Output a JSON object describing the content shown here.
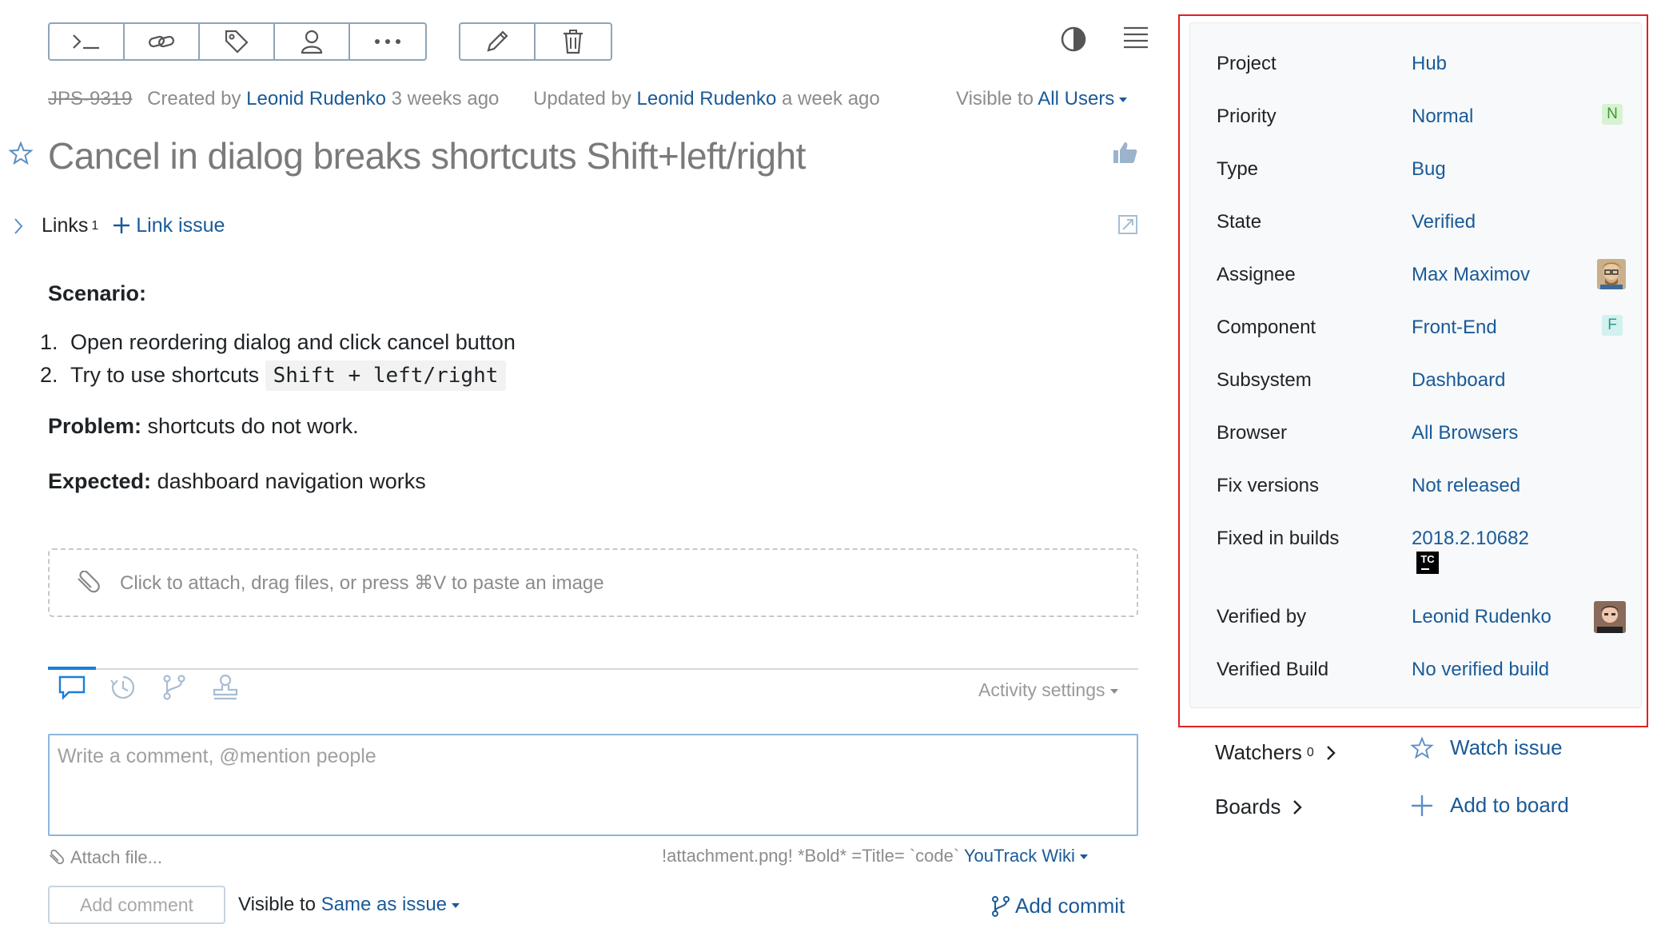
{
  "toolbar": {
    "group1": [
      "terminal-icon",
      "link-icon",
      "tag-icon",
      "user-icon",
      "more-icon"
    ],
    "group2": [
      "pencil-icon",
      "trash-icon"
    ]
  },
  "meta": {
    "issue_id": "JPS-9319",
    "created_prefix": "Created by",
    "created_by": "Leonid Rudenko",
    "created_ago": "3 weeks ago",
    "updated_prefix": "Updated by",
    "updated_by": "Leonid Rudenko",
    "updated_ago": "a week ago",
    "visible_prefix": "Visible to",
    "visible_value": "All Users"
  },
  "title": "Cancel in dialog breaks shortcuts Shift+left/right",
  "links": {
    "label": "Links",
    "count": "1",
    "link_issue": "Link issue"
  },
  "description": {
    "scenario_heading": "Scenario:",
    "step1": "Open reordering dialog and click cancel button",
    "step2_text": "Try to use shortcuts",
    "step2_code": "Shift + left/right",
    "problem_label": "Problem:",
    "problem_text": "shortcuts do not work.",
    "expected_label": "Expected:",
    "expected_text": "dashboard navigation works"
  },
  "attach_box": {
    "text": "Click to attach, drag files, or press ⌘V to paste an image"
  },
  "activity": {
    "settings_label": "Activity settings"
  },
  "comment": {
    "placeholder": "Write a comment, @mention people",
    "attach_file": "Attach file...",
    "wiki_hint": "!attachment.png! *Bold* =Title= `code`",
    "wiki_link": "YouTrack Wiki",
    "add_comment": "Add comment",
    "visible_prefix": "Visible to",
    "visible_value": "Same as issue",
    "add_commit": "Add commit"
  },
  "fields": {
    "project": {
      "label": "Project",
      "value": "Hub"
    },
    "priority": {
      "label": "Priority",
      "value": "Normal",
      "badge": "N"
    },
    "type": {
      "label": "Type",
      "value": "Bug"
    },
    "state": {
      "label": "State",
      "value": "Verified"
    },
    "assignee": {
      "label": "Assignee",
      "value": "Max Maximov"
    },
    "component": {
      "label": "Component",
      "value": "Front-End",
      "badge": "F"
    },
    "subsystem": {
      "label": "Subsystem",
      "value": "Dashboard"
    },
    "browser": {
      "label": "Browser",
      "value": "All Browsers"
    },
    "fix_versions": {
      "label": "Fix versions",
      "value": "Not released"
    },
    "fixed_in_builds": {
      "label": "Fixed in builds",
      "value": "2018.2.10682",
      "badge": "TC"
    },
    "verified_by": {
      "label": "Verified by",
      "value": "Leonid Rudenko"
    },
    "verified_build": {
      "label": "Verified Build",
      "value": "No verified build"
    }
  },
  "watchers": {
    "label": "Watchers",
    "count": "0",
    "action": "Watch issue"
  },
  "boards": {
    "label": "Boards",
    "action": "Add to board"
  },
  "colors": {
    "link": "#1a5a98",
    "highlight_border": "#e02020",
    "priority_badge_bg": "#d6f2d2",
    "component_badge_bg": "#d3f1ee"
  }
}
